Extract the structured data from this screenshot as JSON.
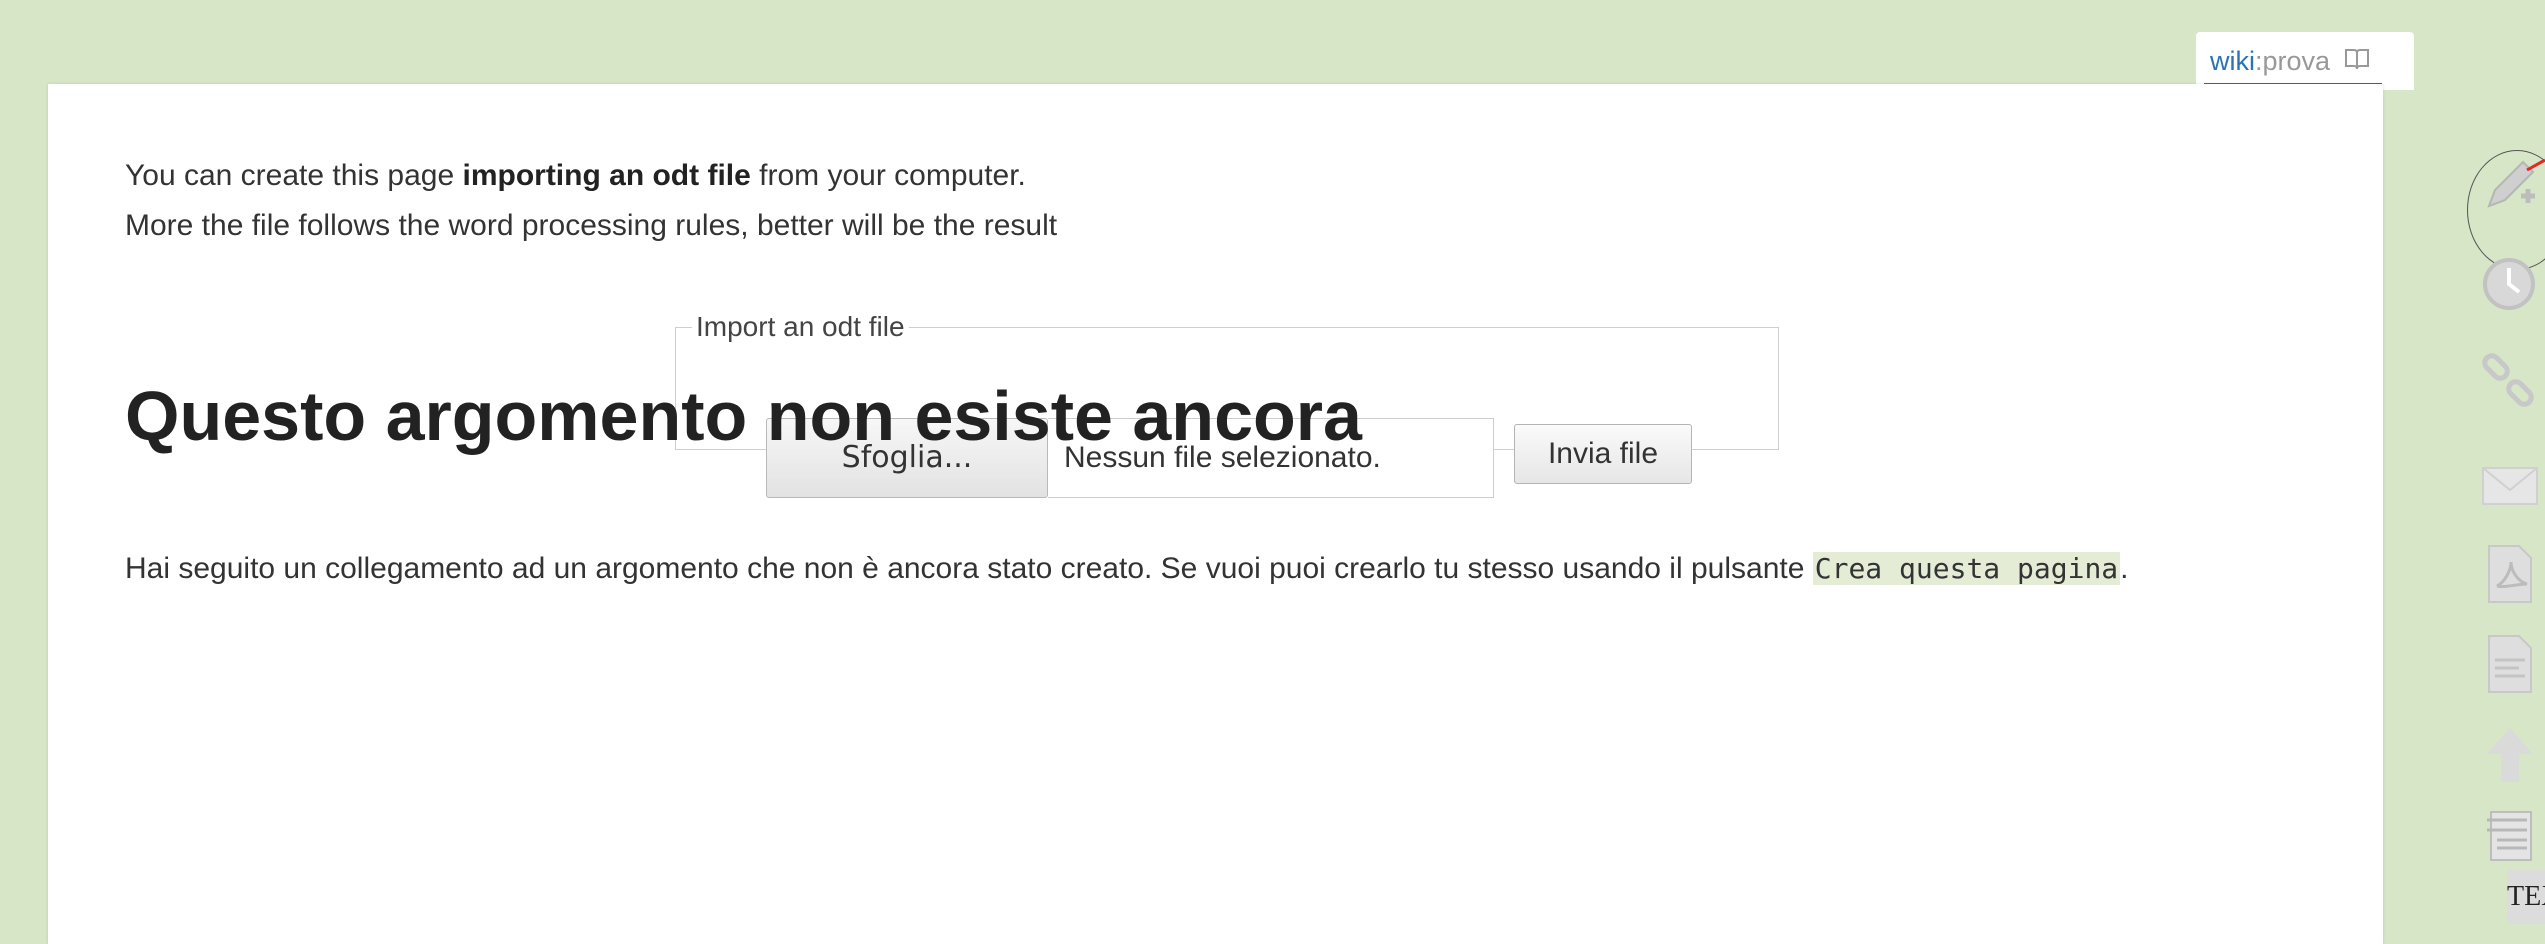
{
  "page_id": {
    "namespace": "wiki",
    "separator": ":",
    "name": "prova",
    "icon": "book-icon"
  },
  "intro": {
    "line1_pre": "You can create this page ",
    "line1_bold": "importing an odt file",
    "line1_post": " from your computer.",
    "line2": "More the file follows the word processing rules, better will be the result"
  },
  "import_form": {
    "legend": "Import an odt file",
    "browse_label": "Sfoglia...",
    "no_file_text": "Nessun file selezionato.",
    "submit_label": "Invia file"
  },
  "main": {
    "heading": "Questo argomento non esiste ancora",
    "text_pre": "Hai seguito un collegamento ad un argomento che non è ancora stato creato. Se vuoi puoi crearlo tu stesso usando il pulsante ",
    "code": "Crea questa pagina",
    "text_post": "."
  },
  "toolbar": {
    "items": [
      {
        "name": "create-page-icon"
      },
      {
        "name": "revisions-icon"
      },
      {
        "name": "backlinks-icon"
      },
      {
        "name": "email-icon"
      },
      {
        "name": "pdf-export-icon"
      },
      {
        "name": "odt-export-icon"
      },
      {
        "name": "back-to-top-icon"
      },
      {
        "name": "media-manager-icon"
      }
    ],
    "tex_label": "TEX"
  },
  "colors": {
    "background": "#d6e6c6",
    "link": "#2b73b7",
    "accent": "#e32626",
    "code_bg": "#e4ecd6"
  }
}
